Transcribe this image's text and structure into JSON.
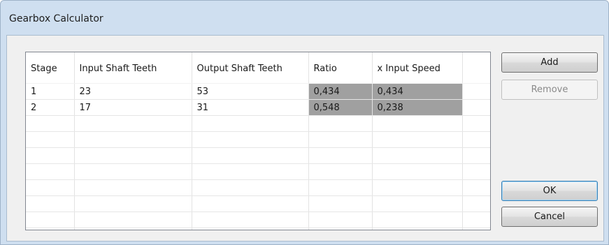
{
  "window": {
    "title": "Gearbox Calculator"
  },
  "table": {
    "columns": [
      "Stage",
      "Input Shaft Teeth",
      "Output Shaft Teeth",
      "Ratio",
      "x Input Speed"
    ],
    "rows": [
      [
        "1",
        "23",
        "53",
        "0,434",
        "0,434"
      ],
      [
        "2",
        "17",
        "31",
        "0,548",
        "0,238"
      ]
    ],
    "computed_cell_color": "#a0a0a0"
  },
  "buttons": {
    "add": "Add",
    "remove": "Remove",
    "ok": "OK",
    "cancel": "Cancel"
  }
}
